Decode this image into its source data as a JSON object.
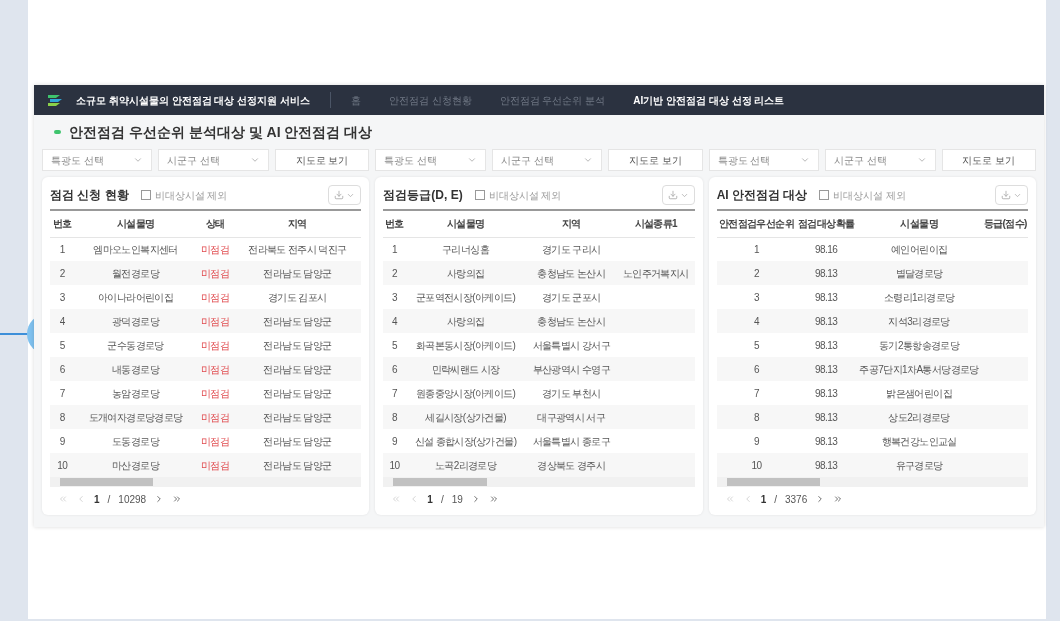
{
  "nav": {
    "title": "소규모 취약시설물의 안전점검 대상 선정지원 서비스",
    "items": [
      {
        "label": "홈",
        "selected": false
      },
      {
        "label": "안전점검 신청현황",
        "selected": false
      },
      {
        "label": "안전점검 우선순위 분석",
        "selected": false
      },
      {
        "label": "AI기반 안전점검 대상 선정 리스트",
        "selected": true
      }
    ]
  },
  "page_title": "안전점검 우선순위 분석대상 및 AI 안전점검 대상",
  "panels": [
    {
      "filters": {
        "province_placeholder": "특광도 선택",
        "district_placeholder": "시군구 선택",
        "map_button": "지도로 보기"
      },
      "title": "점검 신청 현황",
      "exclude": {
        "label": "비대상시설 제외",
        "checked": false
      },
      "columns": [
        {
          "label": "번호",
          "kind": "text"
        },
        {
          "label": "시설물명",
          "kind": "text"
        },
        {
          "label": "상태",
          "kind": "status"
        },
        {
          "label": "지역",
          "kind": "text"
        }
      ],
      "rows": [
        [
          "1",
          "엠마오노인복지센터",
          "미점검",
          "전라북도 전주시 덕진구"
        ],
        [
          "2",
          "월전경로당",
          "미점검",
          "전라남도 담양군"
        ],
        [
          "3",
          "아이나라어린이집",
          "미점검",
          "경기도 김포시"
        ],
        [
          "4",
          "광덕경로당",
          "미점검",
          "전라남도 담양군"
        ],
        [
          "5",
          "군수동경로당",
          "미점검",
          "전라남도 담양군"
        ],
        [
          "6",
          "내동경로당",
          "미점검",
          "전라남도 담양군"
        ],
        [
          "7",
          "농암경로당",
          "미점검",
          "전라남도 담양군"
        ],
        [
          "8",
          "도개여자경로당경로당",
          "미점검",
          "전라남도 담양군"
        ],
        [
          "9",
          "도동경로당",
          "미점검",
          "전라남도 담양군"
        ],
        [
          "10",
          "마산경로당",
          "미점검",
          "전라남도 담양군"
        ]
      ],
      "pagination": {
        "current": "1",
        "separator": "/",
        "total": "10298"
      }
    },
    {
      "filters": {
        "province_placeholder": "특광도 선택",
        "district_placeholder": "시군구 선택",
        "map_button": "지도로 보기"
      },
      "title": "점검등급(D, E)",
      "exclude": {
        "label": "비대상시설 제외",
        "checked": false
      },
      "columns": [
        {
          "label": "번호",
          "kind": "text"
        },
        {
          "label": "시설물명",
          "kind": "text"
        },
        {
          "label": "지역",
          "kind": "text"
        },
        {
          "label": "시설종류1",
          "kind": "text"
        }
      ],
      "rows": [
        [
          "1",
          "구리너싱홈",
          "경기도 구리시",
          ""
        ],
        [
          "2",
          "사랑의집",
          "충청남도 논산시",
          "노인주거복지시"
        ],
        [
          "3",
          "군포역전시장(아케이드)",
          "경기도 군포시",
          ""
        ],
        [
          "4",
          "사랑의집",
          "충청남도 논산시",
          ""
        ],
        [
          "5",
          "화곡본동시장(아케이드)",
          "서울특별시 강서구",
          ""
        ],
        [
          "6",
          "민락씨랜드 시장",
          "부산광역시 수영구",
          ""
        ],
        [
          "7",
          "원종중앙시장(아케이드)",
          "경기도 부천시",
          ""
        ],
        [
          "8",
          "세길시장(상가건물)",
          "대구광역시 서구",
          ""
        ],
        [
          "9",
          "신설 종합시장(상가건물)",
          "서울특별시 종로구",
          ""
        ],
        [
          "10",
          "노곡2리경로당",
          "경상북도 경주시",
          ""
        ]
      ],
      "pagination": {
        "current": "1",
        "separator": "/",
        "total": "19"
      }
    },
    {
      "filters": {
        "province_placeholder": "특광도 선택",
        "district_placeholder": "시군구 선택",
        "map_button": "지도로 보기"
      },
      "title": "AI 안전점검 대상",
      "exclude": {
        "label": "비대상시설 제외",
        "checked": false
      },
      "columns": [
        {
          "label": "안전점검우선순위",
          "kind": "text"
        },
        {
          "label": "점검대상확률",
          "kind": "text"
        },
        {
          "label": "시설물명",
          "kind": "text"
        },
        {
          "label": "등급(점수)",
          "kind": "text"
        }
      ],
      "rows": [
        [
          "1",
          "98.16",
          "예인어린이집",
          ""
        ],
        [
          "2",
          "98.13",
          "별달경로당",
          ""
        ],
        [
          "3",
          "98.13",
          "소령리1리경로당",
          ""
        ],
        [
          "4",
          "98.13",
          "지석3리경로당",
          ""
        ],
        [
          "5",
          "98.13",
          "동기2통항송경로당",
          ""
        ],
        [
          "6",
          "98.13",
          "주공7단지1차A통서당경로당",
          ""
        ],
        [
          "7",
          "98.13",
          "밝은샘어린이집",
          ""
        ],
        [
          "8",
          "98.13",
          "상도2리경로당",
          ""
        ],
        [
          "9",
          "98.13",
          "행복건강노인교실",
          ""
        ],
        [
          "10",
          "98.13",
          "유구경로당",
          ""
        ]
      ],
      "pagination": {
        "current": "1",
        "separator": "/",
        "total": "3376"
      }
    }
  ]
}
